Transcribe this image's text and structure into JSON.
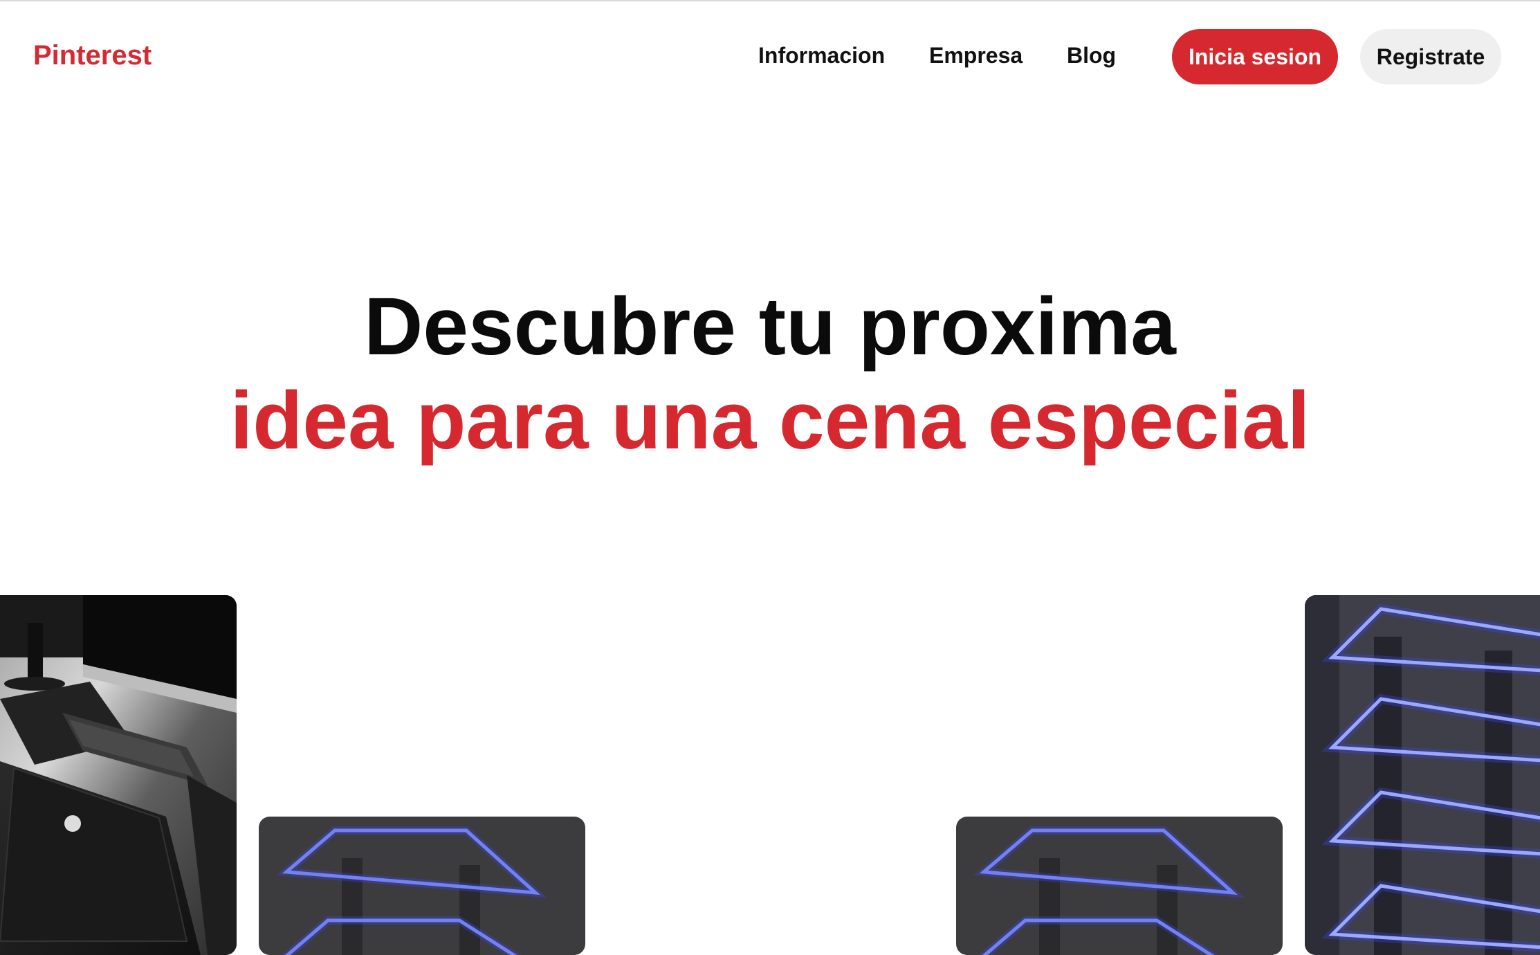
{
  "header": {
    "logo": "Pinterest",
    "nav": [
      "Informacion",
      "Empresa",
      "Blog"
    ],
    "login_label": "Inicia sesion",
    "signup_label": "Registrate"
  },
  "hero": {
    "line1": "Descubre tu proxima",
    "line2": "idea para una cena especial"
  },
  "gallery": {
    "images": [
      "laptop-desk-photo",
      "glowing-shelves-photo",
      "glowing-shelves-photo",
      "glowing-shelves-photo"
    ]
  },
  "colors": {
    "brand_red": "#d6292f",
    "signup_bg": "#efefef"
  }
}
